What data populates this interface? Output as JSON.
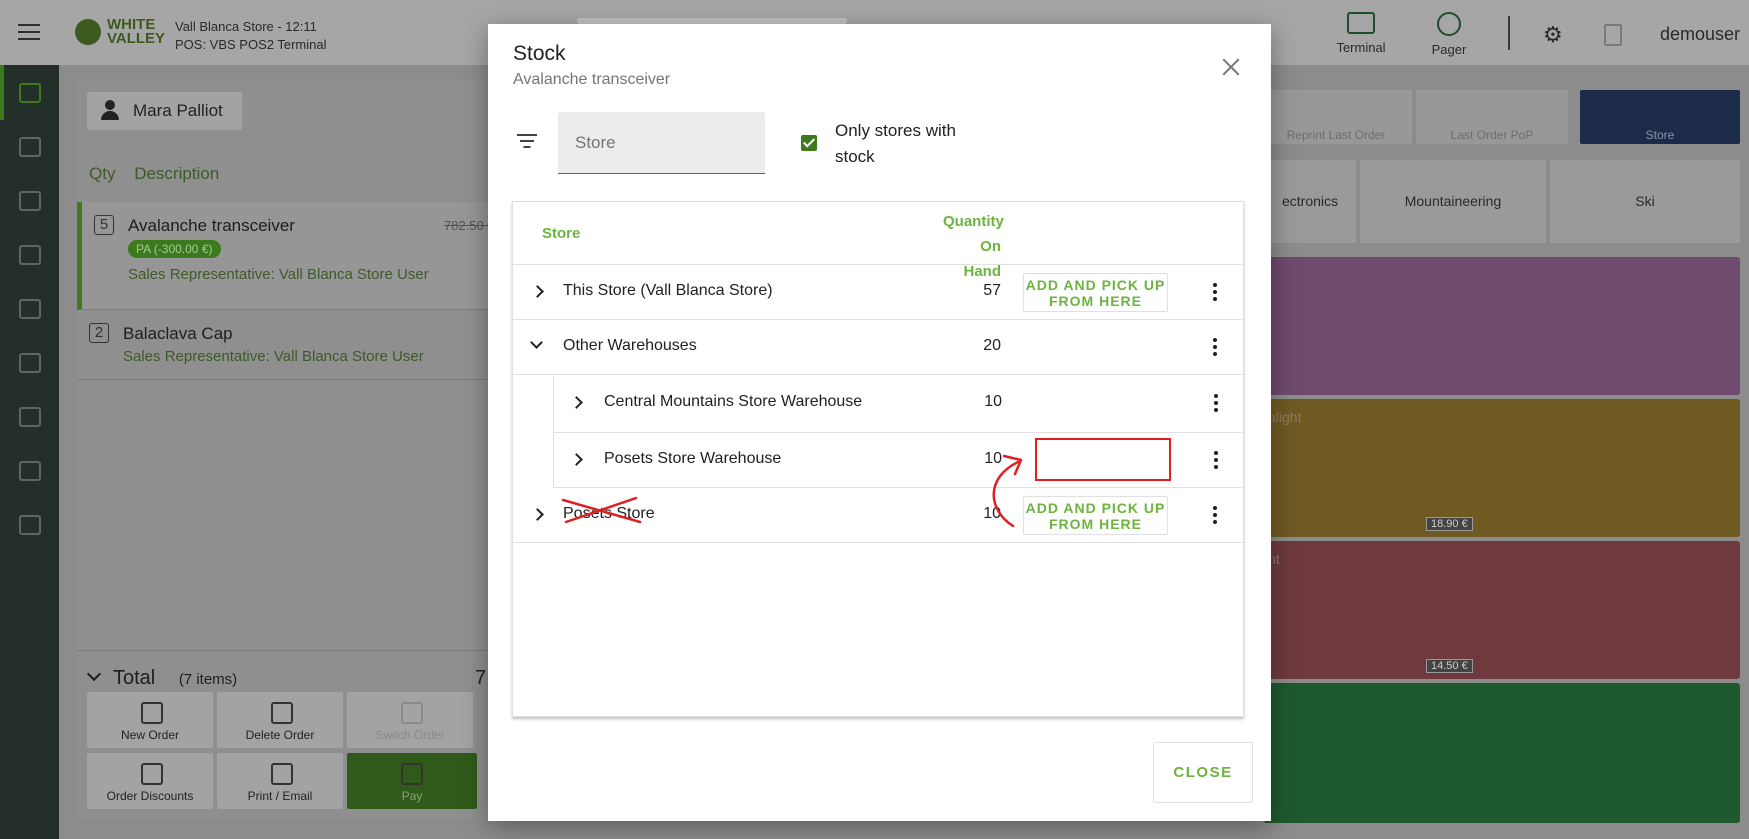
{
  "topbar": {
    "logo_text": "WHITE VALLEY",
    "store_line": "Vall Blanca Store - 12:11",
    "terminal_line": "POS: VBS POS2 Terminal",
    "terminal_label": "Terminal",
    "pager_label": "Pager",
    "user": "demouser"
  },
  "order": {
    "customer": "Mara Palliot",
    "col_qty": "Qty",
    "col_desc": "Description",
    "lines": [
      {
        "qty": "5",
        "name": "Avalanche transceiver",
        "price": "782.50 €",
        "badge": "PA (-300.00 €)",
        "sales": "Sales Representative: Vall Blanca Store User"
      },
      {
        "qty": "2",
        "name": "Balaclava Cap",
        "sales": "Sales Representative: Vall Blanca Store User"
      }
    ],
    "total_label": "Total",
    "total_items": "(7 items)",
    "total_amount": "7",
    "buttons": {
      "new_order": "New Order",
      "delete_order": "Delete Order",
      "switch_order": "Switch Order",
      "order_discounts": "Order Discounts",
      "print_email": "Print / Email",
      "pay": "Pay"
    }
  },
  "right": {
    "tiles": {
      "receipt": "Reprint Last Order",
      "last_order": "Last Order PoP",
      "store": "Store"
    },
    "categories": [
      "ectronics",
      "Mountaineering",
      "Ski"
    ],
    "products": [
      {
        "title": "",
        "price": ""
      },
      {
        "title": "alight",
        "price": "18.90 €"
      },
      {
        "title": "nt",
        "price": "14.50 €"
      },
      {
        "title": "",
        "price": ""
      }
    ]
  },
  "dialog": {
    "title": "Stock",
    "subtitle": "Avalanche transceiver",
    "filter_placeholder": "Store",
    "only_stock_label": "Only stores with stock",
    "col_store": "Store",
    "col_qty": "Quantity On Hand",
    "rows": [
      {
        "name": "This Store (Vall Blanca Store)",
        "qty": "57",
        "action": "ADD AND PICK UP FROM HERE"
      },
      {
        "name": "Other Warehouses",
        "qty": "20"
      },
      {
        "name": "Central Mountains Store Warehouse",
        "qty": "10"
      },
      {
        "name": "Posets Store Warehouse",
        "qty": "10"
      },
      {
        "name": "Posets Store",
        "qty": "10",
        "action": "ADD AND PICK UP FROM HERE"
      }
    ],
    "close_label": "CLOSE"
  },
  "colors": {
    "accent": "#6db33f",
    "annotation": "#e02020"
  }
}
